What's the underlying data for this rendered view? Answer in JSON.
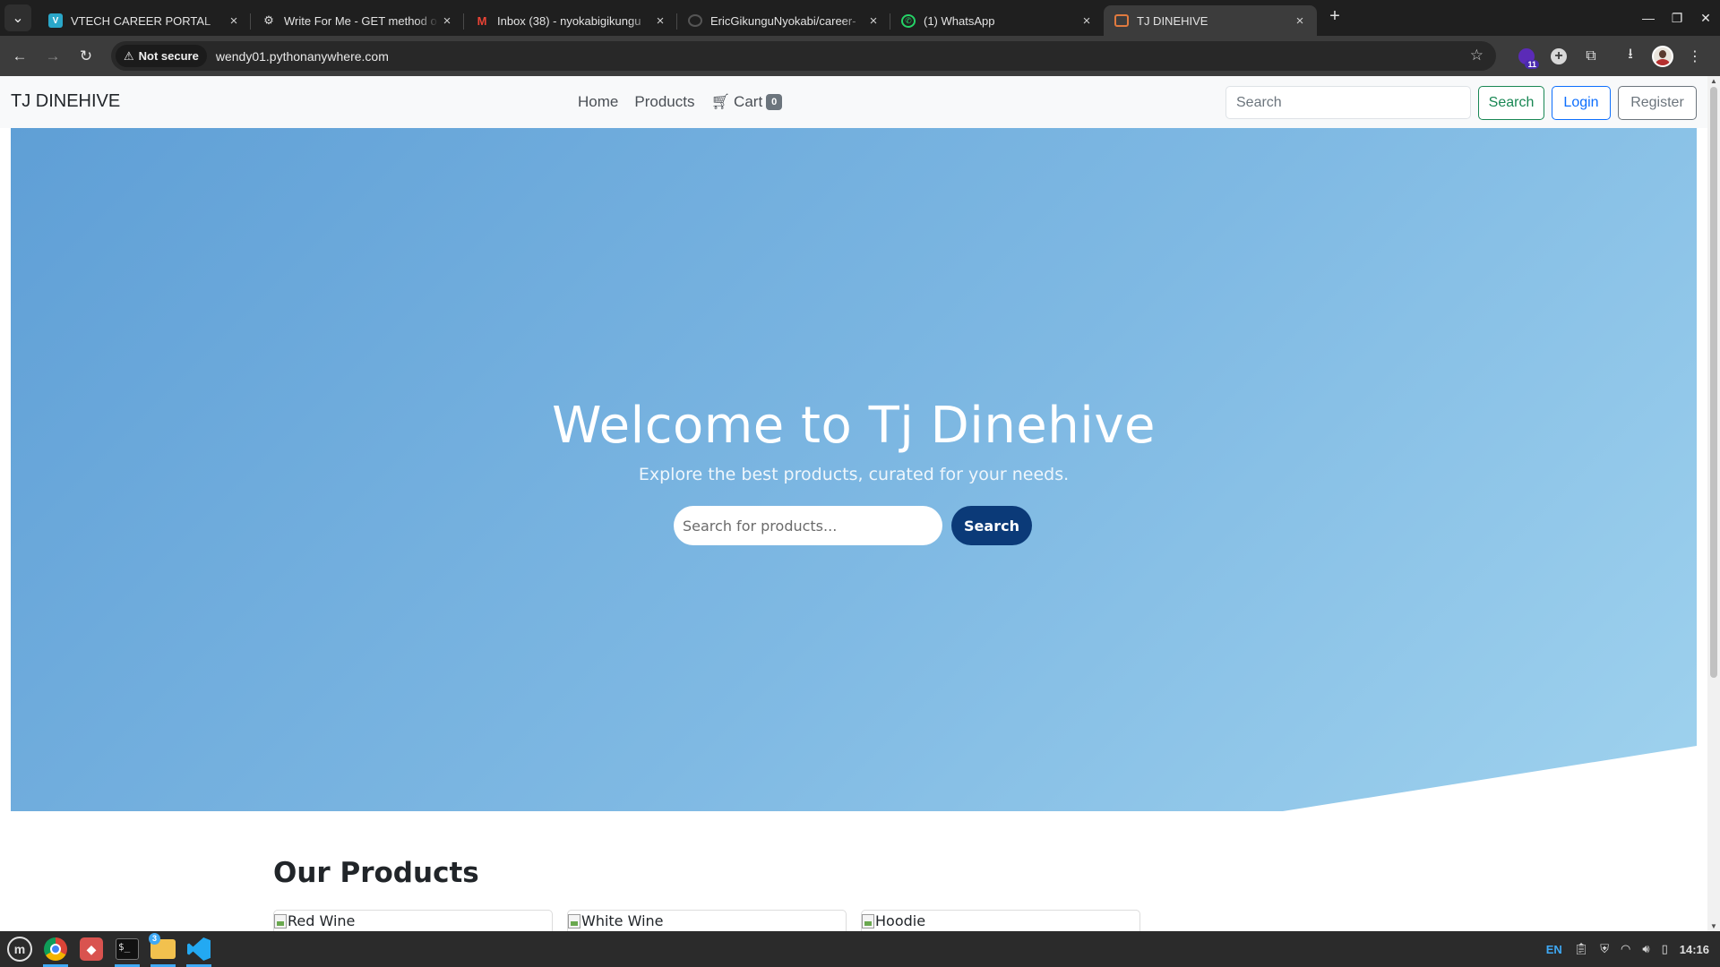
{
  "browser": {
    "tabs": [
      {
        "title": "VTECH CAREER PORTAL",
        "icon": "vtech-favicon",
        "active": false
      },
      {
        "title": "Write For Me - GET method o",
        "icon": "openai-favicon",
        "active": false
      },
      {
        "title": "Inbox (38) - nyokabigikungu",
        "icon": "gmail-favicon",
        "active": false
      },
      {
        "title": "EricGikunguNyokabi/career-",
        "icon": "github-favicon",
        "active": false
      },
      {
        "title": "(1) WhatsApp",
        "icon": "whatsapp-favicon",
        "active": false
      },
      {
        "title": "TJ DINEHIVE",
        "icon": "site-favicon",
        "active": true
      }
    ],
    "security_chip": "Not secure",
    "url": "wendy01.pythonanywhere.com",
    "extension_badge": "11"
  },
  "site": {
    "brand": "TJ DINEHIVE",
    "nav": {
      "home": "Home",
      "products": "Products",
      "cart": "Cart",
      "cart_count": "0"
    },
    "search_placeholder": "Search",
    "search_button": "Search",
    "login_button": "Login",
    "register_button": "Register"
  },
  "hero": {
    "title": "Welcome to Tj Dinehive",
    "subtitle": "Explore the best products, curated for your needs.",
    "search_placeholder": "Search for products...",
    "search_button": "Search",
    "gradient_start": "#5f9fd6",
    "gradient_end": "#9fd2ee"
  },
  "products": {
    "heading": "Our Products",
    "items": [
      {
        "alt": "Red Wine"
      },
      {
        "alt": "White Wine"
      },
      {
        "alt": "Hoodie"
      }
    ]
  },
  "taskbar": {
    "folder_badge": "3",
    "language": "EN",
    "clock": "14:16"
  },
  "colors": {
    "success": "#198754",
    "primary": "#0d6efd",
    "secondary": "#6c757d",
    "hero_button": "#0b3a78"
  }
}
